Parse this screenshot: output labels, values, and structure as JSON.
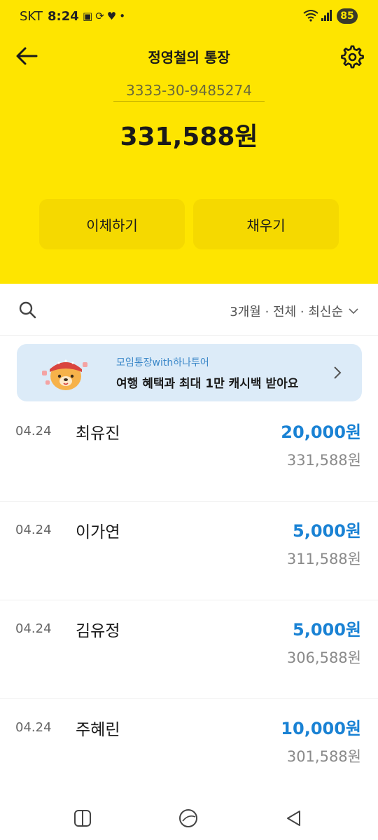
{
  "status_bar": {
    "carrier": "SKT",
    "time": "8:24",
    "battery": "85",
    "notification_icons": [
      "screenshot-icon",
      "sync-icon",
      "heart-icon",
      "dot-icon"
    ]
  },
  "header": {
    "title": "정영철의 통장"
  },
  "account": {
    "number": "3333-30-9485274",
    "balance": "331,588원"
  },
  "actions": {
    "transfer_label": "이체하기",
    "fill_label": "채우기"
  },
  "filter": {
    "label": "3개월 · 전체 · 최신순"
  },
  "promo": {
    "subtitle": "모임통장with하나투어",
    "title": "여행 혜택과 최대 1만 캐시백 받아요"
  },
  "transactions": [
    {
      "date": "04.24",
      "name": "최유진",
      "amount": "20,000원",
      "balance_after": "331,588원"
    },
    {
      "date": "04.24",
      "name": "이가연",
      "amount": "5,000원",
      "balance_after": "311,588원"
    },
    {
      "date": "04.24",
      "name": "김유정",
      "amount": "5,000원",
      "balance_after": "306,588원"
    },
    {
      "date": "04.24",
      "name": "주혜린",
      "amount": "10,000원",
      "balance_after": "301,588원"
    }
  ],
  "colors": {
    "header_yellow": "#fee500",
    "deposit_blue": "#1a82d4",
    "promo_bg": "#dcebf8"
  }
}
